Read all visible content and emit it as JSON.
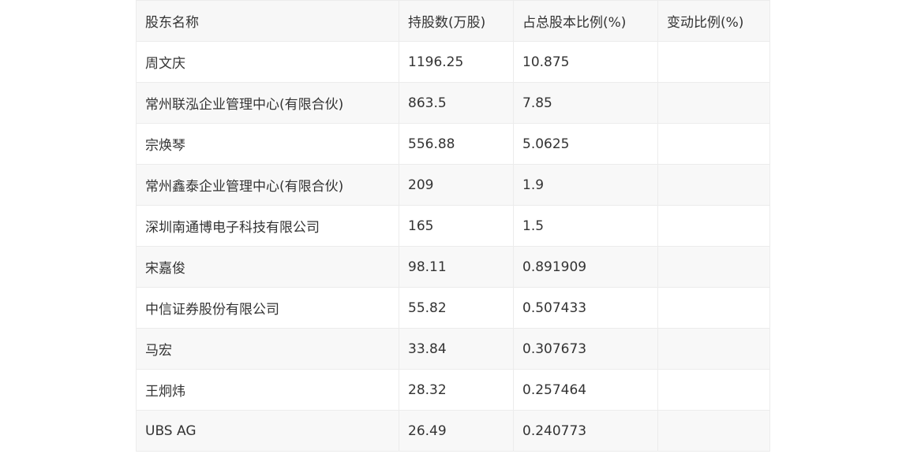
{
  "table": {
    "headers": [
      "股东名称",
      "持股数(万股)",
      "占总股本比例(%)",
      "变动比例(%)"
    ],
    "rows": [
      [
        "周文庆",
        "1196.25",
        "10.875",
        ""
      ],
      [
        "常州联泓企业管理中心(有限合伙)",
        "863.5",
        "7.85",
        ""
      ],
      [
        "宗焕琴",
        "556.88",
        "5.0625",
        ""
      ],
      [
        "常州鑫泰企业管理中心(有限合伙)",
        "209",
        "1.9",
        ""
      ],
      [
        "深圳南通博电子科技有限公司",
        "165",
        "1.5",
        ""
      ],
      [
        "宋嘉俊",
        "98.11",
        "0.891909",
        ""
      ],
      [
        "中信证券股份有限公司",
        "55.82",
        "0.507433",
        ""
      ],
      [
        "马宏",
        "33.84",
        "0.307673",
        ""
      ],
      [
        "王炯炜",
        "28.32",
        "0.257464",
        ""
      ],
      [
        "UBS AG",
        "26.49",
        "0.240773",
        ""
      ]
    ]
  }
}
